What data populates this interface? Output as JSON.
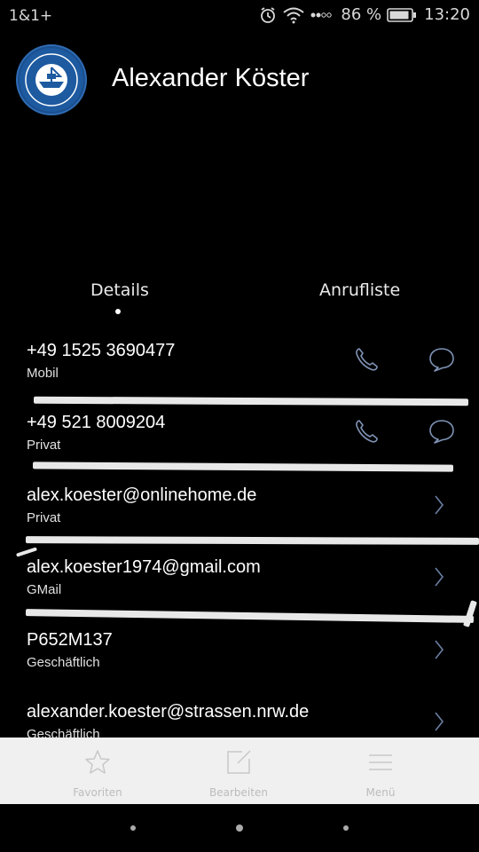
{
  "status": {
    "carrier": "1&1+",
    "battery_percent": "86 %",
    "time": "13:20"
  },
  "contact": {
    "name": "Alexander Köster"
  },
  "tabs": [
    {
      "label": "Details",
      "selected": true
    },
    {
      "label": "Anrufliste",
      "selected": false
    }
  ],
  "entries": [
    {
      "value": "+49 1525 3690477",
      "label": "Mobil",
      "type": "phone"
    },
    {
      "value": "+49 521 8009204",
      "label": "Privat",
      "type": "phone"
    },
    {
      "value": "alex.koester@onlinehome.de",
      "label": "Privat",
      "type": "link"
    },
    {
      "value": "alex.koester1974@gmail.com",
      "label": "GMail",
      "type": "link"
    },
    {
      "value": "P652M137",
      "label": "Geschäftlich",
      "type": "link"
    },
    {
      "value": "alexander.koester@strassen.nrw.de",
      "label": "Geschäftlich",
      "type": "link"
    }
  ],
  "toolbar": {
    "favorites": "Favoriten",
    "edit": "Bearbeiten",
    "menu": "Menü"
  },
  "colors": {
    "background": "#000000",
    "accent_icon": "#7f93b5",
    "toolbar_bg": "#f0f0f0"
  }
}
